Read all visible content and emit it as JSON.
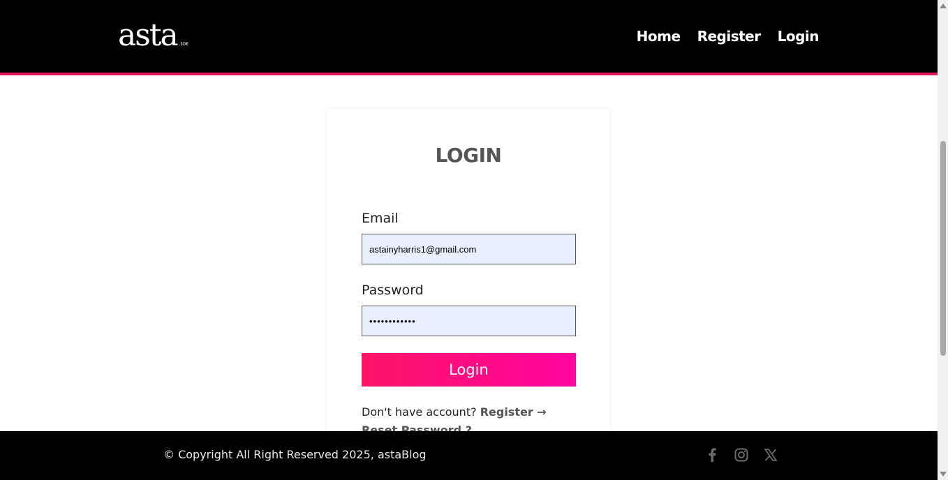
{
  "header": {
    "logo_text": "asta",
    "logo_suffix": ".ɪᴏᴇ",
    "nav": [
      "Home",
      "Register",
      "Login"
    ]
  },
  "login": {
    "title": "LOGIN",
    "email_label": "Email",
    "email_value": "astainyharris1@gmail.com",
    "password_label": "Password",
    "password_value": "••••••••••••",
    "submit_label": "Login",
    "no_account_text": "Don't have account?",
    "register_link": "Register →",
    "reset_link": "Reset Password ?"
  },
  "footer": {
    "copyright": "© Copyright All Right Reserved 2025, astaBlog",
    "social_icons": [
      "facebook-icon",
      "instagram-icon",
      "x-icon"
    ]
  },
  "colors": {
    "accent": "#ff0a78",
    "header_bg": "#000000",
    "input_bg": "#e8f0fe"
  }
}
